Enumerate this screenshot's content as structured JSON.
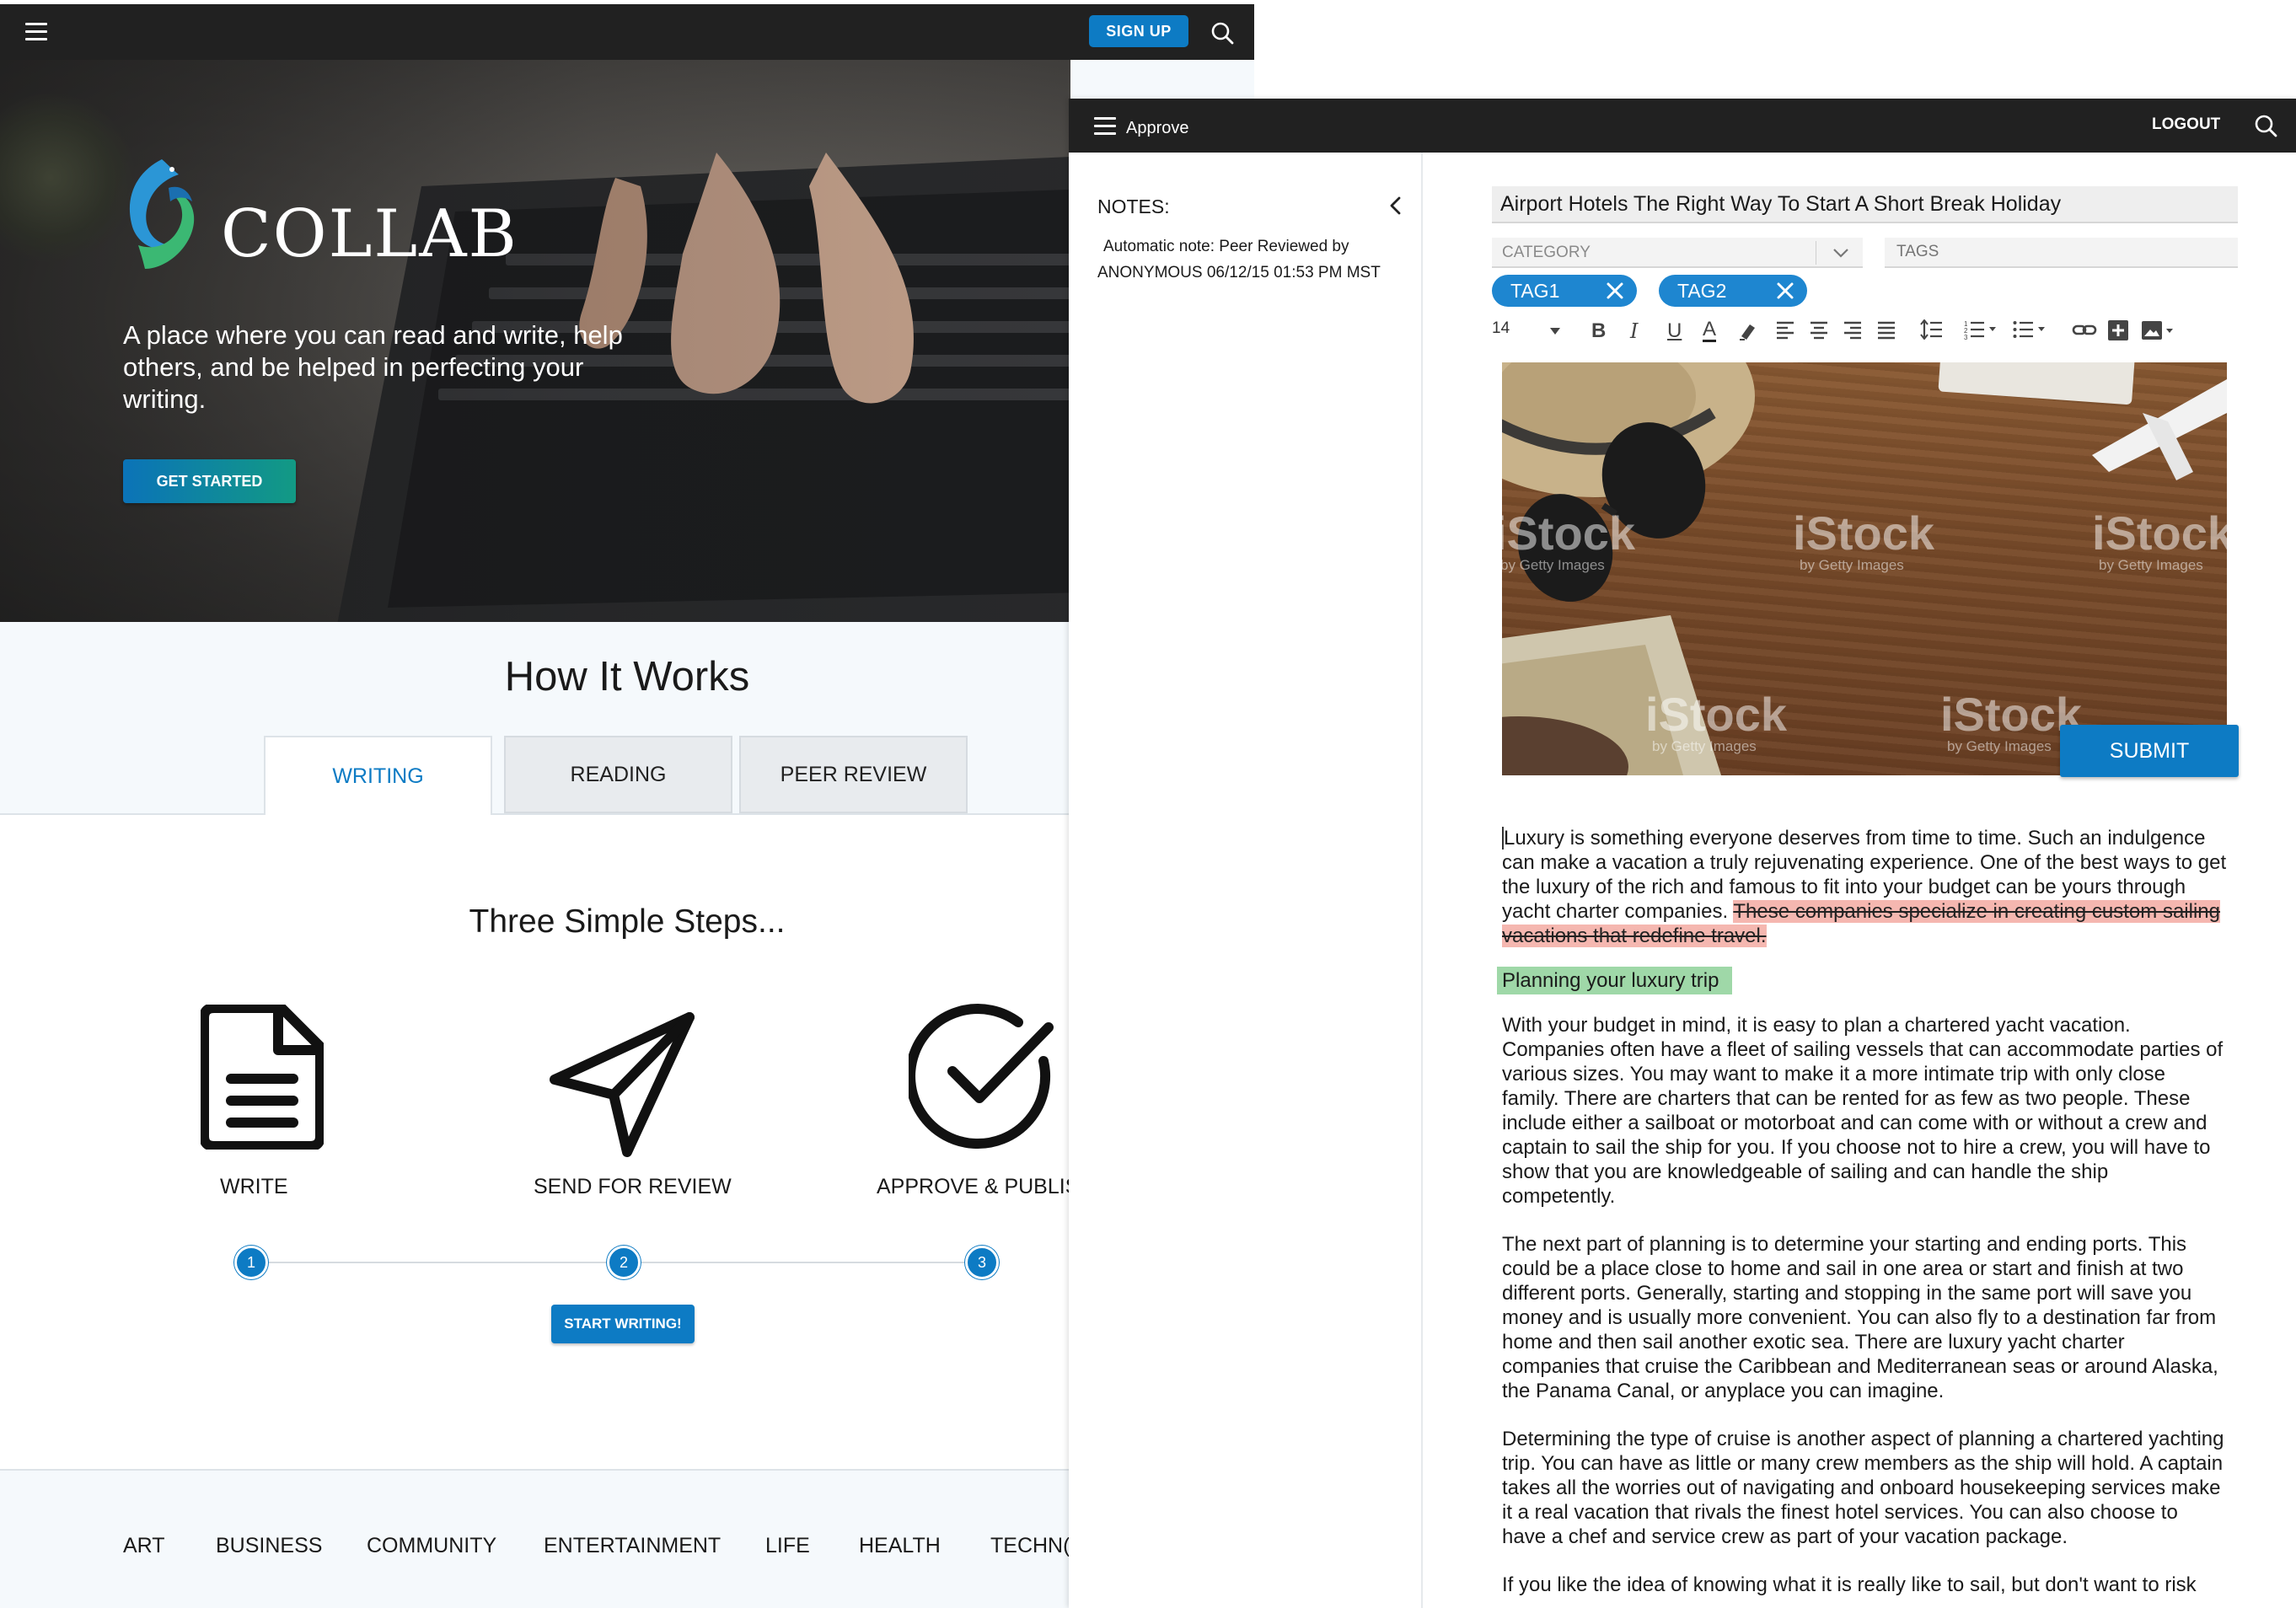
{
  "left": {
    "signup_label": "SIGN UP",
    "brand": "COLLAB",
    "tagline": "A place where you can read and write, help others, and be helped in perfecting your writing.",
    "get_started_label": "GET STARTED",
    "how_title": "How It Works",
    "tabs": [
      {
        "label": "WRITING",
        "active": true
      },
      {
        "label": "READING",
        "active": false
      },
      {
        "label": "PEER REVIEW",
        "active": false
      }
    ],
    "steps_title": "Three Simple Steps...",
    "steps": [
      {
        "label": "WRITE",
        "number": "1",
        "icon": "document-icon"
      },
      {
        "label": "SEND FOR REVIEW",
        "number": "2",
        "icon": "paper-plane-icon"
      },
      {
        "label": "APPROVE & PUBLIS",
        "number": "3",
        "icon": "checkmark-circle-icon"
      }
    ],
    "start_writing_label": "START WRITING!",
    "categories": [
      "ART",
      "BUSINESS",
      "COMMUNITY",
      "ENTERTAINMENT",
      "LIFE",
      "HEALTH",
      "TECHN("
    ]
  },
  "right": {
    "app_title": "Approve",
    "logout_label": "LOGOUT",
    "notes_title": "NOTES:",
    "note_line1": "Automatic note: Peer Reviewed by",
    "note_line2": "ANONYMOUS 06/12/15 01:53 PM MST",
    "article_title": "Airport Hotels The Right Way To Start A Short Break Holiday",
    "category_placeholder": "CATEGORY",
    "tags_placeholder": "TAGS",
    "tags": [
      "TAG1",
      "TAG2"
    ],
    "font_size": "14",
    "toolbar": {
      "bold": "B",
      "italic": "I",
      "underline": "U",
      "font_color": "A"
    },
    "submit_label": "SUBMIT",
    "image_watermark": "iStock",
    "image_watermark_sub": "by Getty Images",
    "paragraph1": "Luxury is something everyone deserves from time to time. Such an indulgence can make a vacation a truly rejuvenating experience. One of the best ways to get the luxury of the rich and famous to fit into your budget can be yours through yacht charter companies.",
    "paragraph1_deleted": "These companies specialize in creating custom sailing vacations that redefine travel.",
    "section_heading": "Planning your luxury trip",
    "paragraph2": "With your budget in mind, it is easy to plan a chartered yacht vacation. Companies often have a fleet of sailing vessels that can accommodate parties of various sizes. You may want to make it a more intimate trip with only close family. There are charters that can be rented for as few as two people. These include either a sailboat or motorboat and can come with or without a crew and captain to sail the ship for you. If you choose not to hire a crew, you will have to show that you are knowledgeable of sailing and can handle the ship competently.",
    "paragraph3": "The next part of planning is to determine your starting and ending ports. This could be a place close to home and sail in one area or start and finish at two different ports. Generally, starting and stopping in the same port will save you money and is usually more convenient. You can also fly to a destination far from home and then sail another exotic sea. There are luxury yacht charter companies that cruise the Caribbean and Mediterranean seas or around Alaska, the Panama Canal, or anyplace you can imagine.",
    "paragraph4": "Determining the type of cruise is another aspect of planning a chartered yachting trip. You can have as little or many crew members as the ship will hold. A captain takes all the worries out of navigating and onboard housekeeping services make it a real vacation that rivals the finest hotel services. You can also choose to have a chef and service crew as part of your vacation package.",
    "paragraph5": "If you like the idea of knowing what it is really like to sail, but don't want to risk"
  }
}
